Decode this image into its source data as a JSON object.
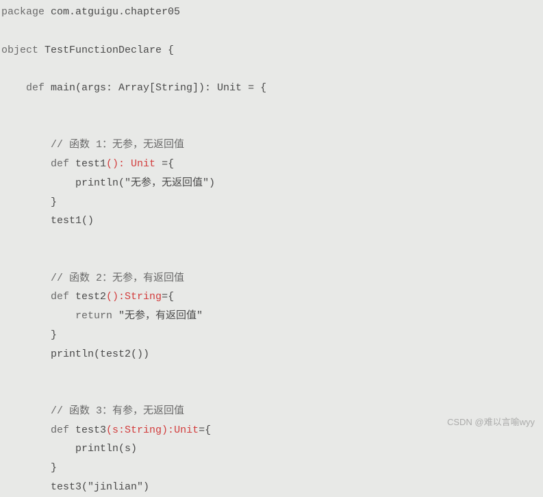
{
  "code": {
    "pkg_kw": "package",
    "pkg_name": " com.atguigu.chapter05",
    "obj_kw": "object ",
    "obj_name": "TestFunctionDeclare {",
    "main_def": "    def ",
    "main_sig": "main(args: Array[String]): Unit = {",
    "c1": "        // 函数 1：无参，无返回值",
    "t1_def": "        def ",
    "t1_name": "test1",
    "t1_sig": "(): Unit ",
    "t1_eq": "={",
    "t1_body": "            println(",
    "t1_str": "\"无参，无返回值\"",
    "t1_close": ")",
    "t1_brace": "        }",
    "t1_call": "        test1()",
    "c2": "        // 函数 2：无参，有返回值",
    "t2_def": "        def ",
    "t2_name": "test2",
    "t2_sig": "():String",
    "t2_eq": "={",
    "t2_ret": "            return ",
    "t2_str": "\"无参，有返回值\"",
    "t2_brace": "        }",
    "t2_call": "        println(test2())",
    "c3": "        // 函数 3：有参，无返回值",
    "t3_def": "        def ",
    "t3_name": "test3",
    "t3_sig": "(s:String):Unit",
    "t3_eq": "={",
    "t3_body": "            println(s)",
    "t3_brace": "        }",
    "t3_call": "        test3(",
    "t3_arg": "\"jinlian\"",
    "t3_close": ")"
  },
  "watermark": "CSDN @难以言喻wyy"
}
